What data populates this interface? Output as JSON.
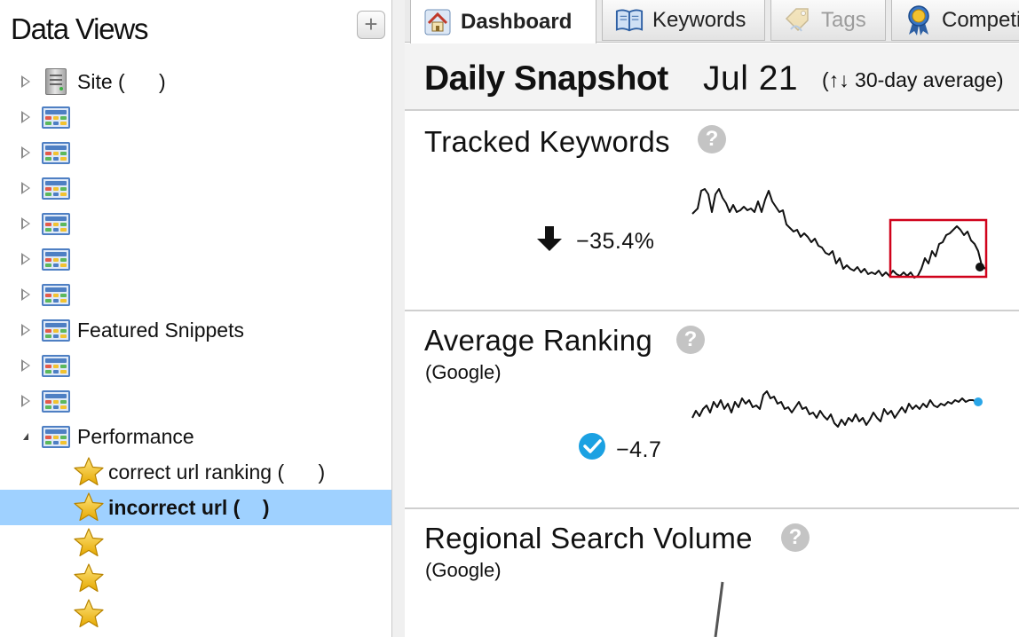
{
  "sidebar": {
    "title": "Data Views",
    "add_button": "+",
    "tree": [
      {
        "label": "Site (      )",
        "icon": "server-icon",
        "state": "collapsed"
      },
      {
        "label": "",
        "icon": "grid-view-icon",
        "state": "collapsed"
      },
      {
        "label": "",
        "icon": "grid-view-icon",
        "state": "collapsed"
      },
      {
        "label": "",
        "icon": "grid-view-icon",
        "state": "collapsed"
      },
      {
        "label": "",
        "icon": "grid-view-icon",
        "state": "collapsed"
      },
      {
        "label": "",
        "icon": "grid-view-icon",
        "state": "collapsed"
      },
      {
        "label": "",
        "icon": "grid-view-icon",
        "state": "collapsed"
      },
      {
        "label": "Featured Snippets",
        "icon": "grid-view-icon",
        "state": "collapsed"
      },
      {
        "label": "",
        "icon": "grid-view-icon",
        "state": "collapsed"
      },
      {
        "label": "",
        "icon": "grid-view-icon",
        "state": "collapsed"
      },
      {
        "label": "Performance",
        "icon": "grid-view-icon",
        "state": "expanded"
      }
    ],
    "starred": [
      {
        "label": "correct url ranking (      )",
        "selected": false
      },
      {
        "label": "incorrect url (    )",
        "selected": true
      },
      {
        "label": "",
        "selected": false
      },
      {
        "label": "",
        "selected": false
      },
      {
        "label": "",
        "selected": false
      }
    ]
  },
  "tabs": [
    {
      "label": "Dashboard",
      "icon": "home-icon",
      "active": true,
      "disabled": false
    },
    {
      "label": "Keywords",
      "icon": "book-icon",
      "active": false,
      "disabled": false
    },
    {
      "label": "Tags",
      "icon": "tag-icon",
      "active": false,
      "disabled": true
    },
    {
      "label": "Competitors",
      "icon": "award-ribbon-icon",
      "active": false,
      "disabled": false
    }
  ],
  "snapshot": {
    "title": "Daily Snapshot",
    "date": "Jul 21",
    "note": "(↑↓ 30-day average)"
  },
  "panels": {
    "tracked_keywords": {
      "title": "Tracked Keywords",
      "help": "?",
      "change": "−35.4%",
      "trend": "down"
    },
    "average_ranking": {
      "title": "Average Ranking",
      "subtitle": "(Google)",
      "help": "?",
      "change": "−4.7"
    },
    "regional_search_volume": {
      "title": "Regional Search Volume",
      "subtitle": "(Google)",
      "help": "?"
    }
  },
  "colors": {
    "selection": "#9fd1ff",
    "highlight_box": "#d0021b",
    "check_badge": "#1ba1e2",
    "ranking_endpoint": "#2aa6e8"
  }
}
